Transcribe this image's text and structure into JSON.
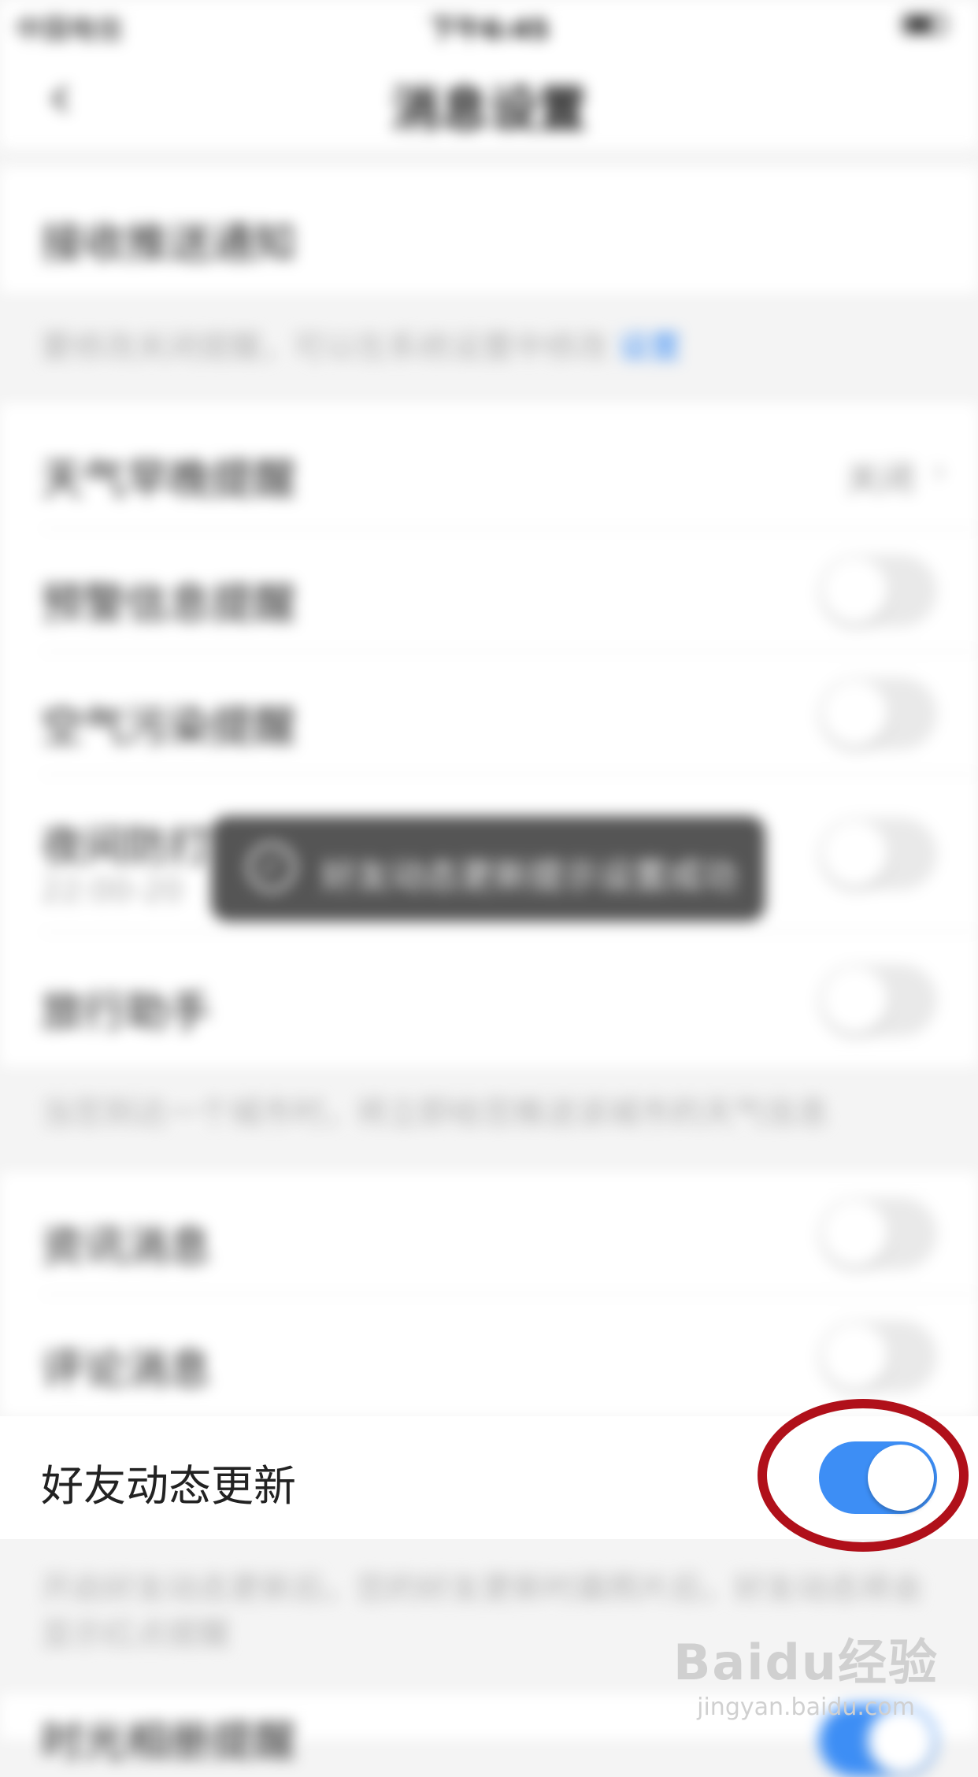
{
  "status_bar": {
    "carrier": "中国电信",
    "time": "下午6:45"
  },
  "nav": {
    "back_glyph": "‹",
    "title": "消息设置"
  },
  "push": {
    "label": "接收推送通知"
  },
  "push_note": {
    "text": "要修改关闭提醒，可以在系统设置中修改 ",
    "link": "设置"
  },
  "rows": {
    "weather": {
      "label": "天气早晚提醒",
      "value": "关闭"
    },
    "warning": {
      "label": "预警信息提醒"
    },
    "air": {
      "label": "空气污染提醒"
    },
    "night": {
      "label": "夜间防打扰",
      "sub": "22:00-20"
    },
    "travel": {
      "label": "旅行助手"
    },
    "news": {
      "label": "资讯消息"
    },
    "comment": {
      "label": "评论消息"
    },
    "friends": {
      "label": "好友动态更新"
    }
  },
  "travel_note": {
    "text": "当您到达一个城市时，将立即给您推送该城市的天气信息"
  },
  "friends_note": {
    "text": "开启好友动态更新后，您的好友更新时晨照片后，好友动态将会显示红点提醒"
  },
  "bottom_row": {
    "label": "时光相册提醒"
  },
  "toast": {
    "check_glyph": "✓",
    "message": "好友动态更新提示设置成功"
  },
  "watermark": {
    "brand": "Baidu经验",
    "url": "jingyan.baidu.com"
  },
  "toggles": {
    "warning": false,
    "air": false,
    "night": false,
    "travel": false,
    "news": false,
    "comment": false,
    "friends": true,
    "bottom": true
  },
  "colors": {
    "accent": "#3d8ef5",
    "annotation": "#b0101a"
  }
}
